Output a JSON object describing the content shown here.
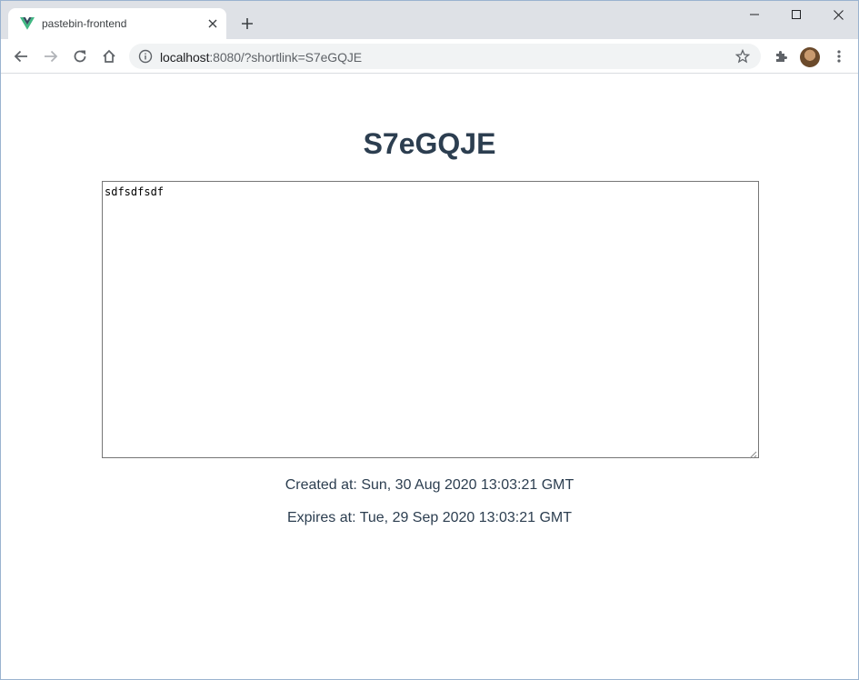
{
  "browser": {
    "tab": {
      "title": "pastebin-frontend",
      "favicon": "vue-logo-icon"
    },
    "address": {
      "host": "localhost",
      "path": ":8080/?shortlink=S7eGQJE"
    },
    "icons": [
      "back-icon",
      "forward-icon",
      "reload-icon",
      "home-icon",
      "info-icon",
      "star-icon",
      "extensions-icon",
      "avatar",
      "menu-icon"
    ]
  },
  "paste": {
    "title": "S7eGQJE",
    "content": "sdfsdfsdf",
    "created_label": "Created at: Sun, 30 Aug 2020 13:03:21 GMT",
    "expires_label": "Expires at: Tue, 29 Sep 2020 13:03:21 GMT"
  },
  "colors": {
    "heading": "#2c3e50",
    "tabstrip": "#dee1e6",
    "omnibox": "#f1f3f4",
    "vue_green": "#41b883",
    "vue_dark": "#35495e"
  }
}
